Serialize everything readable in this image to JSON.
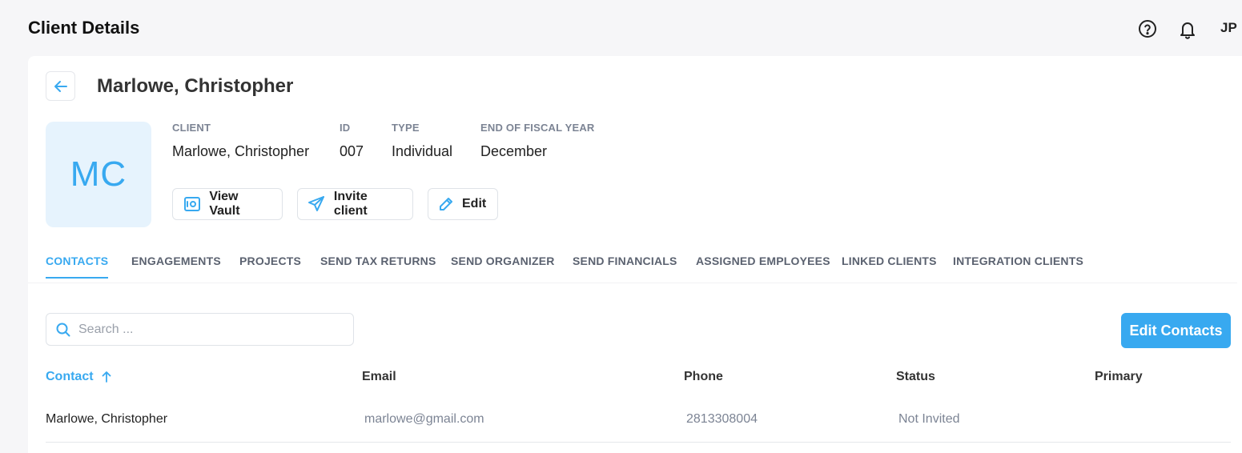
{
  "header": {
    "page_title": "Client Details",
    "user_initials": "JP"
  },
  "client": {
    "display_name": "Marlowe, Christopher",
    "avatar_initials": "MC",
    "fields": [
      {
        "label": "CLIENT",
        "value": "Marlowe, Christopher"
      },
      {
        "label": "ID",
        "value": "007"
      },
      {
        "label": "TYPE",
        "value": "Individual"
      },
      {
        "label": "END OF FISCAL YEAR",
        "value": "December"
      }
    ]
  },
  "actions": {
    "view_vault": "View Vault",
    "invite_client": "Invite client",
    "edit": "Edit"
  },
  "tabs": [
    {
      "label": "CONTACTS",
      "active": true
    },
    {
      "label": "ENGAGEMENTS"
    },
    {
      "label": "PROJECTS"
    },
    {
      "label": "SEND TAX RETURNS"
    },
    {
      "label": "SEND ORGANIZER"
    },
    {
      "label": "SEND FINANCIALS"
    },
    {
      "label": "ASSIGNED EMPLOYEES"
    },
    {
      "label": "LINKED CLIENTS"
    },
    {
      "label": "INTEGRATION CLIENTS"
    }
  ],
  "search": {
    "placeholder": "Search ...",
    "value": ""
  },
  "edit_contacts_label": "Edit Contacts",
  "table": {
    "columns": [
      "Contact",
      "Email",
      "Phone",
      "Status",
      "Primary"
    ],
    "sorted_column": "Contact",
    "sort_direction": "ascending",
    "rows": [
      {
        "contact": "Marlowe, Christopher",
        "email": "marlowe@gmail.com",
        "phone": "2813308004",
        "status": "Not Invited",
        "primary": ""
      }
    ]
  },
  "colors": {
    "accent": "#38a9f0",
    "avatar_bg": "#e6f3fd",
    "page_bg": "#f6f6f8"
  }
}
